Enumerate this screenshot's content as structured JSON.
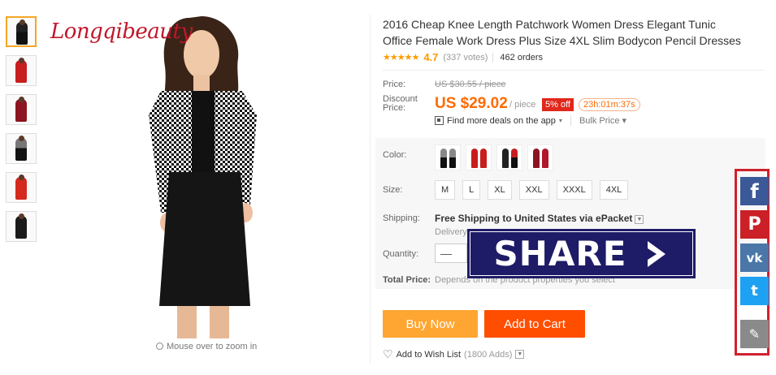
{
  "brand": {
    "logo_text": "Longqibeauty"
  },
  "gallery": {
    "thumbnails": [
      {
        "name": "houndstooth-black"
      },
      {
        "name": "red"
      },
      {
        "name": "wine"
      },
      {
        "name": "houndstooth-2"
      },
      {
        "name": "red-2"
      },
      {
        "name": "black"
      }
    ],
    "zoom_hint": "Mouse over to zoom in"
  },
  "product": {
    "title": "2016 Cheap Knee Length Patchwork Women Dress Elegant Tunic Office Female Work Dress Plus Size 4XL Slim Bodycon Pencil Dresses",
    "stars": "★★★★★",
    "rating": "4.7",
    "votes": "(337 votes)",
    "orders": "462 orders"
  },
  "pricing": {
    "price_label": "Price:",
    "old_price": "US $30.55 / piece",
    "discount_label": "Discount Price:",
    "new_price": "US $29.02",
    "per_piece": "/ piece",
    "off_badge": "5% off",
    "timer": "23h:01m:37s",
    "deals_text": "Find more deals on the app",
    "bulk_price": "Bulk Price ▾"
  },
  "options": {
    "color_label": "Color:",
    "size_label": "Size:",
    "sizes": [
      "M",
      "L",
      "XL",
      "XXL",
      "XXXL",
      "4XL"
    ],
    "shipping_label": "Shipping:",
    "shipping_text": "Free Shipping to United States via ePacket",
    "delivery_text": "Delivery",
    "quantity_label": "Quantity:",
    "quantity_minus": "—",
    "total_label": "Total Price:",
    "total_value": "Depends on the product properties you select"
  },
  "actions": {
    "buy_now": "Buy Now",
    "add_to_cart": "Add to Cart",
    "wishlist": "Add to Wish List",
    "wishlist_count": "(1800 Adds)"
  },
  "overlay": {
    "share_text": "SHARE"
  },
  "social": {
    "facebook": "f",
    "pinterest": "P",
    "vk": "vk",
    "twitter": "t",
    "edit": "✎"
  },
  "colors": {
    "price_orange": "#ff6a00",
    "buy_now": "#ffa531",
    "add_to_cart": "#ff4e00",
    "share_bg": "#1e1b67",
    "social_border": "#d0202d"
  }
}
